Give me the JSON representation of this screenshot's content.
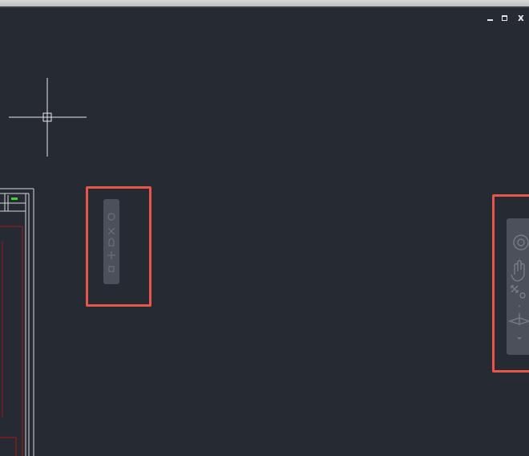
{
  "window_controls": {
    "minimize_glyph": "‒",
    "restore_glyph": "⧉",
    "close_glyph": "x"
  },
  "colors": {
    "canvas_background": "#252a33",
    "highlight_box": "#e8564a",
    "navbar": "#4b505a",
    "drawing_border": "#d8d8d8",
    "drawing_red_line": "#b0151b",
    "status_green": "#39d62b"
  },
  "navigation_bars": [
    {
      "id": "collapsed",
      "tools": [
        "steering-wheel-icon",
        "pan-icon",
        "zoom-extents-icon",
        "orbit-icon",
        "showmotion-icon"
      ]
    },
    {
      "id": "expanded",
      "tools": [
        "steering-wheel-icon",
        "pan-icon",
        "zoom-extents-icon",
        "orbit-icon"
      ]
    }
  ]
}
